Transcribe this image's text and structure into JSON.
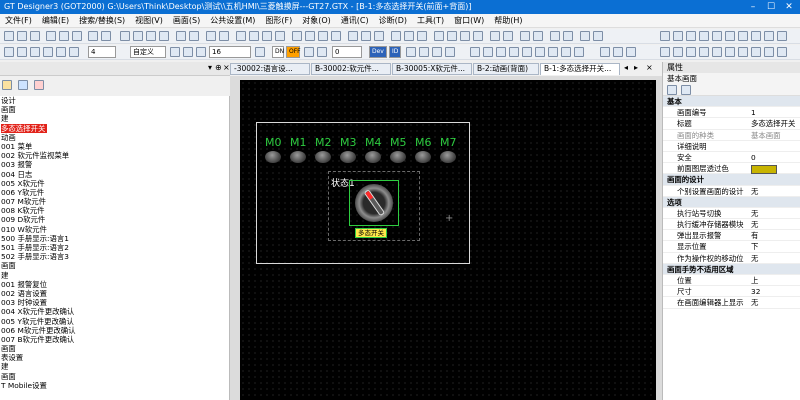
{
  "titlebar": {
    "title": "GT Designer3 (GOT2000) G:\\Users\\Think\\Desktop\\测试\\\\五机HMI\\三菱触摸屏---GT27.GTX - [B-1:多态选择开关(前面+背面)]",
    "min": "–",
    "max": "☐",
    "close": "✕"
  },
  "menu": [
    "文件(F)",
    "编辑(E)",
    "搜索/替换(S)",
    "视图(V)",
    "画面(S)",
    "公共设置(M)",
    "图形(F)",
    "对象(O)",
    "通讯(C)",
    "诊断(D)",
    "工具(T)",
    "窗口(W)",
    "帮助(H)"
  ],
  "toolbar": {
    "stroke_width": "4",
    "zoom_mode": "自定义",
    "font_size": "16",
    "dn_label": "DN",
    "off_label": "OFF",
    "offset_value": "0",
    "dev_label": "Dev",
    "id_label": "ID"
  },
  "left_panel": {
    "pin": "▾",
    "pin2": "⊕",
    "close": "×"
  },
  "tree": {
    "rows": [
      "设计",
      "画面",
      "建",
      "多态选择开关",
      "动画",
      "001 菜单",
      "002 软元件监视菜单",
      "003 报警",
      "004 日志",
      "005 X软元件",
      "006 Y软元件",
      "007 M软元件",
      "008 K软元件",
      "009 D软元件",
      "010 W软元件",
      "500 手册显示:语言1",
      "501 手册显示:语言2",
      "502 手册显示:语言3",
      "画面",
      "建",
      "001 报警复位",
      "002 语言设置",
      "003 时钟设置",
      "004 X软元件更改确认",
      "005 Y软元件更改确认",
      "006 M软元件更改确认",
      "007 B软元件更改确认",
      "画面",
      "表设置",
      "建",
      "画面",
      "T Mobile设置"
    ],
    "selected_index": 3
  },
  "doc_tabs": [
    "-30002:语言设...",
    "B-30002:软元件...",
    "B-30005:X软元件...",
    "B-2:动画(背面)",
    "B-1:多态选择开关..."
  ],
  "canvas": {
    "lamps": [
      "M0",
      "M1",
      "M2",
      "M3",
      "M4",
      "M5",
      "M6",
      "M7"
    ],
    "state_label": "状态1",
    "switch_tag": "多态开关",
    "cursor": "+"
  },
  "properties": {
    "title": "属性",
    "subtitle": "基本画面",
    "rows": [
      {
        "k": "基本",
        "cat": true
      },
      {
        "k": "画面编号",
        "v": "1"
      },
      {
        "k": "标题",
        "v": "多态选择开关"
      },
      {
        "k": "画面的种类",
        "v": "基本画面",
        "dim": true
      },
      {
        "k": "详细说明",
        "v": ""
      },
      {
        "k": "安全",
        "v": "0"
      },
      {
        "k": "前面图层透过色",
        "v": "",
        "swatch": true
      },
      {
        "k": "画面的设计",
        "cat": true
      },
      {
        "k": "个别设置画面的设计",
        "v": "无"
      },
      {
        "k": "选项",
        "cat": true
      },
      {
        "k": "执行站号切换",
        "v": "无"
      },
      {
        "k": "执行缓冲存储器模块",
        "v": "无"
      },
      {
        "k": "弹出显示报警",
        "v": "有"
      },
      {
        "k": "显示位置",
        "v": "下"
      },
      {
        "k": "作为操作权的移动位",
        "v": "无"
      },
      {
        "k": "画面手势不适用区域",
        "cat": true
      },
      {
        "k": "位置",
        "v": "上"
      },
      {
        "k": "尺寸",
        "v": "32"
      },
      {
        "k": "在画面编辑器上显示",
        "v": "无"
      }
    ],
    "swatch_color": "#c8b400"
  }
}
